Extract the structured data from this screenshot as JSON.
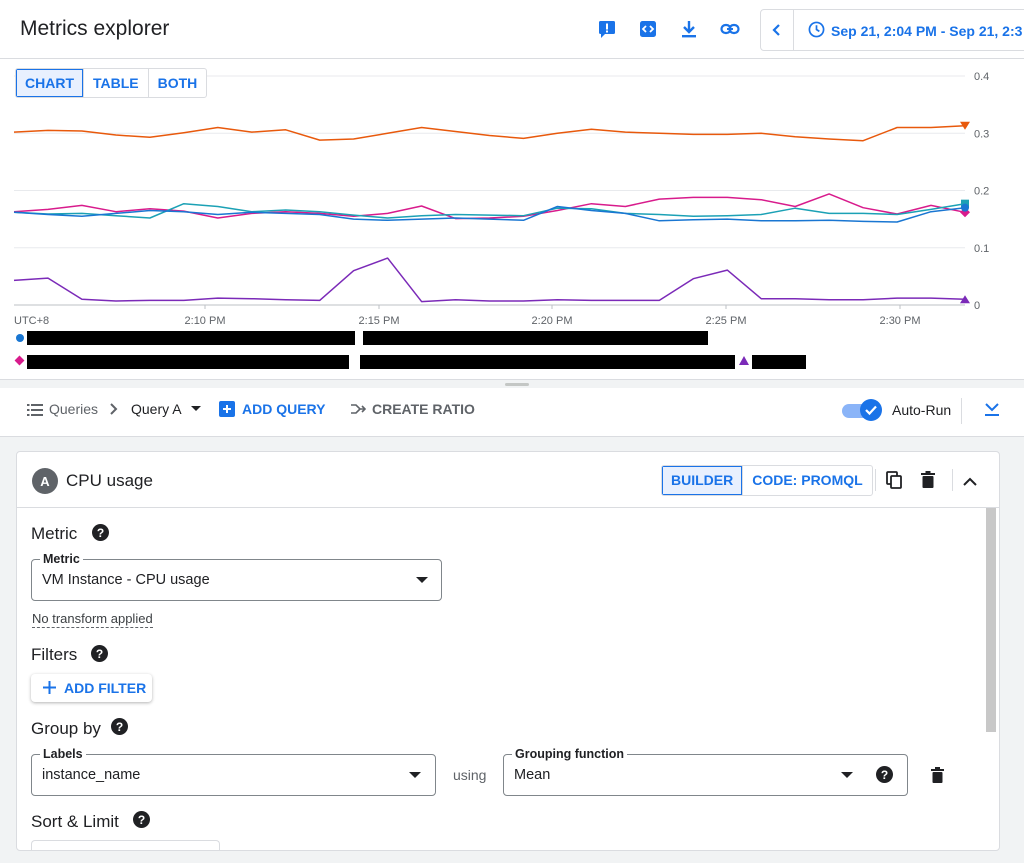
{
  "header": {
    "title": "Metrics explorer",
    "time_range": "Sep 21, 2:04 PM - Sep 21, 2:3",
    "icons": [
      "feedback-icon",
      "code-icon",
      "download-icon",
      "link-icon",
      "chevron-left-icon",
      "clock-icon"
    ]
  },
  "view_toggle": {
    "chart": "CHART",
    "table": "TABLE",
    "both": "BOTH",
    "selected": "CHART"
  },
  "chart_data": {
    "type": "line",
    "title": "",
    "x_categories": [
      "UTC+8",
      "2:10 PM",
      "2:15 PM",
      "2:20 PM",
      "2:25 PM",
      "2:30 PM"
    ],
    "ylim": [
      0,
      0.4
    ],
    "yticks": [
      "0",
      "0.1",
      "0.2",
      "0.3",
      "0.4"
    ],
    "grid": true,
    "series": [
      {
        "color": "#e8590c",
        "marker": "triangle-down",
        "values": [
          0.302,
          0.305,
          0.304,
          0.297,
          0.293,
          0.301,
          0.31,
          0.302,
          0.306,
          0.288,
          0.29,
          0.3,
          0.31,
          0.303,
          0.296,
          0.291,
          0.3,
          0.307,
          0.302,
          0.3,
          0.298,
          0.298,
          0.3,
          0.294,
          0.29,
          0.287,
          0.31,
          0.31,
          0.313
        ]
      },
      {
        "color": "#d81b8c",
        "marker": "diamond",
        "values": [
          0.163,
          0.167,
          0.174,
          0.163,
          0.168,
          0.164,
          0.152,
          0.16,
          0.163,
          0.16,
          0.155,
          0.16,
          0.173,
          0.151,
          0.152,
          0.155,
          0.165,
          0.177,
          0.172,
          0.185,
          0.188,
          0.188,
          0.184,
          0.172,
          0.194,
          0.17,
          0.159,
          0.174,
          0.162
        ]
      },
      {
        "color": "#1ba1b5",
        "marker": "square",
        "values": [
          0.162,
          0.159,
          0.16,
          0.156,
          0.152,
          0.177,
          0.172,
          0.163,
          0.166,
          0.163,
          0.157,
          0.152,
          0.156,
          0.158,
          0.157,
          0.156,
          0.169,
          0.168,
          0.16,
          0.158,
          0.155,
          0.156,
          0.158,
          0.169,
          0.16,
          0.16,
          0.158,
          0.167,
          0.177
        ]
      },
      {
        "color": "#1976d2",
        "marker": "circle",
        "values": [
          0.162,
          0.158,
          0.155,
          0.16,
          0.165,
          0.163,
          0.158,
          0.162,
          0.16,
          0.158,
          0.15,
          0.148,
          0.15,
          0.152,
          0.15,
          0.148,
          0.172,
          0.165,
          0.16,
          0.147,
          0.149,
          0.15,
          0.147,
          0.147,
          0.148,
          0.146,
          0.145,
          0.163,
          0.17
        ]
      },
      {
        "color": "#7b2ab8",
        "marker": "triangle-up",
        "values": [
          0.043,
          0.047,
          0.01,
          0.007,
          0.008,
          0.008,
          0.012,
          0.011,
          0.009,
          0.008,
          0.06,
          0.082,
          0.006,
          0.009,
          0.007,
          0.007,
          0.009,
          0.008,
          0.008,
          0.008,
          0.046,
          0.061,
          0.011,
          0.011,
          0.009,
          0.009,
          0.012,
          0.012,
          0.01
        ]
      }
    ]
  },
  "query_bar": {
    "queries_label": "Queries",
    "current_query": "Query A",
    "add_query": "ADD QUERY",
    "create_ratio": "CREATE RATIO",
    "auto_run_label": "Auto-Run",
    "auto_run_on": true
  },
  "query_card": {
    "badge": "A",
    "title": "CPU usage",
    "builder_label": "BUILDER",
    "code_label": "CODE: PROMQL",
    "metric_section": "Metric",
    "metric_field_label": "Metric",
    "metric_value": "VM Instance - CPU usage",
    "transform_text": "No transform applied",
    "filters_section": "Filters",
    "add_filter": "ADD FILTER",
    "group_by_section": "Group by",
    "labels_field_label": "Labels",
    "labels_value": "instance_name",
    "using_text": "using",
    "grouping_field_label": "Grouping function",
    "grouping_value": "Mean",
    "sort_limit_section": "Sort & Limit",
    "help_glyph": "?"
  }
}
